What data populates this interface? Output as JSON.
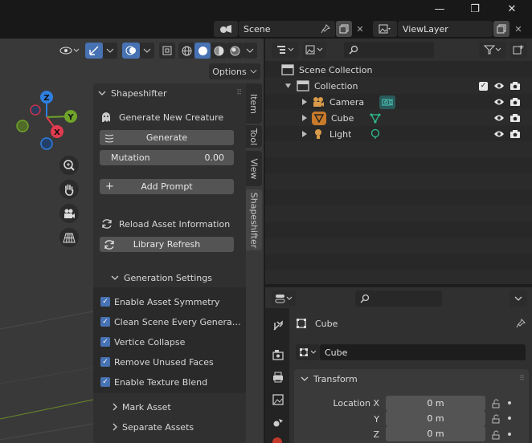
{
  "topbar": {
    "scene_label": "Scene",
    "viewlayer_label": "ViewLayer",
    "window_controls": {
      "minimize": "—",
      "maximize": "❐",
      "close": "✕"
    }
  },
  "viewport": {
    "options_label": "Options",
    "gizmo": {
      "z": "Z",
      "y": "Y",
      "x": "X"
    }
  },
  "npanel": {
    "title": "Shapeshifter",
    "generate_new_creature": "Generate New Creature",
    "generate_button": "Generate",
    "mutation_label": "Mutation",
    "mutation_value": "0.00",
    "add_prompt_button": "Add Prompt",
    "reload_asset_info": "Reload Asset Information",
    "library_refresh_button": "Library Refresh",
    "generation_settings_label": "Generation Settings",
    "checkboxes": [
      {
        "label": "Enable Asset Symmetry",
        "checked": true
      },
      {
        "label": "Clean Scene Every Genera…",
        "checked": true
      },
      {
        "label": "Vertice Collapse",
        "checked": true
      },
      {
        "label": "Remove Unused Faces",
        "checked": true
      },
      {
        "label": "Enable Texture Blend",
        "checked": true
      }
    ],
    "mark_asset_label": "Mark Asset",
    "separate_assets_label": "Separate Assets"
  },
  "tabs": {
    "item": "Item",
    "tool": "Tool",
    "view": "View",
    "shapeshifter": "Shapeshifter"
  },
  "outliner": {
    "scene_collection": "Scene Collection",
    "collection": "Collection",
    "objects": [
      {
        "name": "Camera"
      },
      {
        "name": "Cube"
      },
      {
        "name": "Light"
      }
    ]
  },
  "properties": {
    "object_name": "Cube",
    "data_name": "Cube",
    "transform_label": "Transform",
    "location_x_label": "Location X",
    "y_label": "Y",
    "z_label": "Z",
    "location_x_value": "0 m",
    "location_y_value": "0 m",
    "location_z_value": "0 m"
  },
  "colors": {
    "accent_blue": "#4772b3",
    "axis_x": "#e23a4f",
    "axis_y": "#6fa32a",
    "axis_z": "#2e7fe0",
    "camera_orange": "#d99a4a",
    "mesh_green": "#2fbf8f"
  }
}
